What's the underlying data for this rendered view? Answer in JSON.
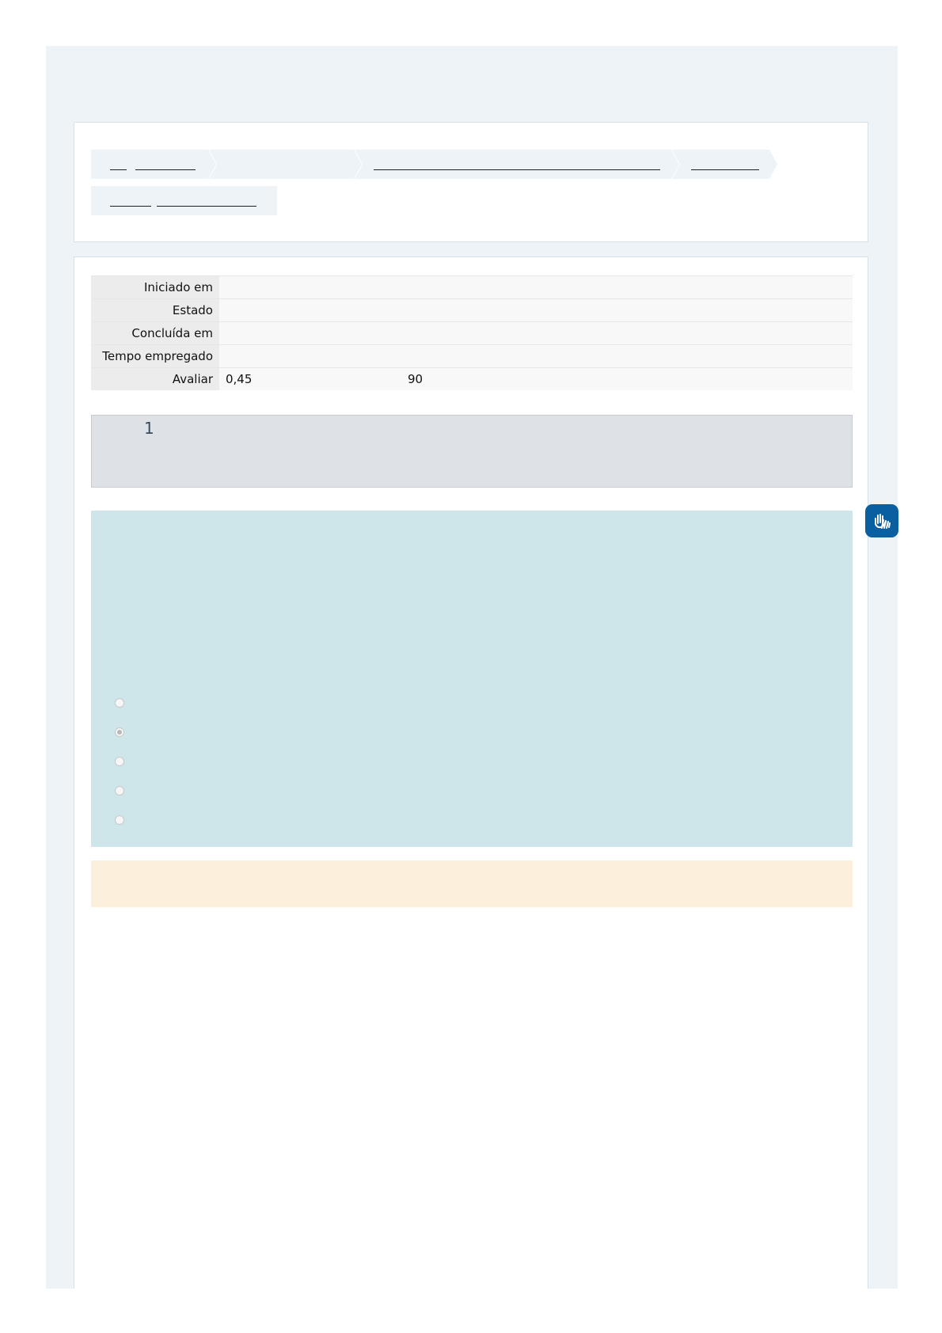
{
  "summary": {
    "rows": [
      {
        "label": "Iniciado em",
        "value": ""
      },
      {
        "label": "Estado",
        "value": ""
      },
      {
        "label": "Concluída em",
        "value": ""
      },
      {
        "label": "Tempo empregado",
        "value": ""
      }
    ],
    "grade": {
      "label": "Avaliar",
      "value": "0,45",
      "max": "90"
    }
  },
  "question": {
    "number": "1",
    "options": [
      {
        "selected": false
      },
      {
        "selected": true
      },
      {
        "selected": false
      },
      {
        "selected": false
      },
      {
        "selected": false
      }
    ]
  },
  "colors": {
    "page_bg": "#edf3f7",
    "question_info_bg": "#dee2e6",
    "question_text_bg": "#cee6ea",
    "feedback_bg": "#fcefdc",
    "accessibility_button": "#0a5fa0"
  },
  "icons": {
    "accessibility": "sign-language-hands-icon"
  }
}
